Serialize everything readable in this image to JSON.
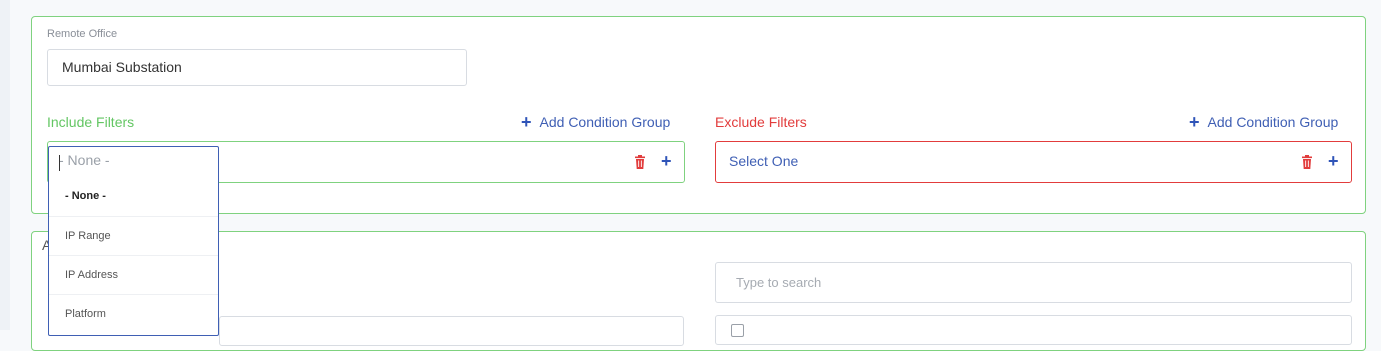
{
  "remote_office": {
    "label": "Remote Office",
    "value": "Mumbai Substation"
  },
  "include_filters": {
    "title": "Include Filters",
    "add_group_label": "Add Condition Group",
    "color": "#63c663"
  },
  "exclude_filters": {
    "title": "Exclude Filters",
    "add_group_label": "Add Condition Group",
    "select_value": "Select One",
    "color": "#e23c3c"
  },
  "dropdown": {
    "input_text": "- None -",
    "options": [
      "- None -",
      "IP Range",
      "IP Address",
      "Platform"
    ],
    "selected_index": 0
  },
  "second_panel": {
    "title_partial": "A",
    "search_placeholder": "Type to search"
  },
  "icons": {
    "add": "plus-icon",
    "delete": "trash-icon"
  }
}
